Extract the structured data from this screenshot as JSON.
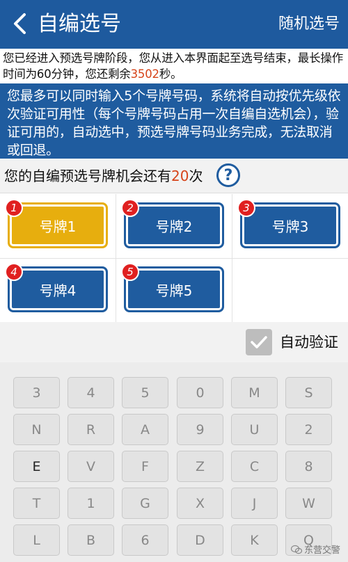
{
  "header": {
    "title": "自编选号",
    "random_label": "随机选号"
  },
  "notice": {
    "prefix": "您已经进入预选号牌阶段，您从进入本界面起至选号结束，最长操作时间为60分钟，您还剩余",
    "seconds": "3502",
    "suffix": "秒。"
  },
  "info": "您最多可以同时输入5个号牌号码，系统将自动按优先级依次验证可用性（每个号牌号码占用一次自编自选机会），验证可用的，自动选中，预选号牌号码业务完成，无法取消或回退。",
  "chance": {
    "prefix": "您的自编预选号牌机会还有",
    "count": "20",
    "suffix": "次",
    "help_symbol": "?"
  },
  "plates": [
    {
      "badge": "1",
      "label": "号牌1",
      "active": true
    },
    {
      "badge": "2",
      "label": "号牌2",
      "active": false
    },
    {
      "badge": "3",
      "label": "号牌3",
      "active": false
    },
    {
      "badge": "4",
      "label": "号牌4",
      "active": false
    },
    {
      "badge": "5",
      "label": "号牌5",
      "active": false
    }
  ],
  "auto_verify": {
    "label": "自动验证",
    "checked": true
  },
  "keyboard": [
    [
      "3",
      "4",
      "5",
      "0",
      "M",
      "S"
    ],
    [
      "N",
      "R",
      "A",
      "9",
      "U",
      "2"
    ],
    [
      "E",
      "V",
      "F",
      "Z",
      "C",
      "8"
    ],
    [
      "T",
      "1",
      "G",
      "X",
      "J",
      "W"
    ],
    [
      "L",
      "B",
      "6",
      "D",
      "K",
      "Q"
    ]
  ],
  "watermark": "东营交警",
  "colors": {
    "primary": "#1f5c9f",
    "selected": "#e7ae0e",
    "highlight": "#d6441a",
    "badge": "#e02020"
  }
}
